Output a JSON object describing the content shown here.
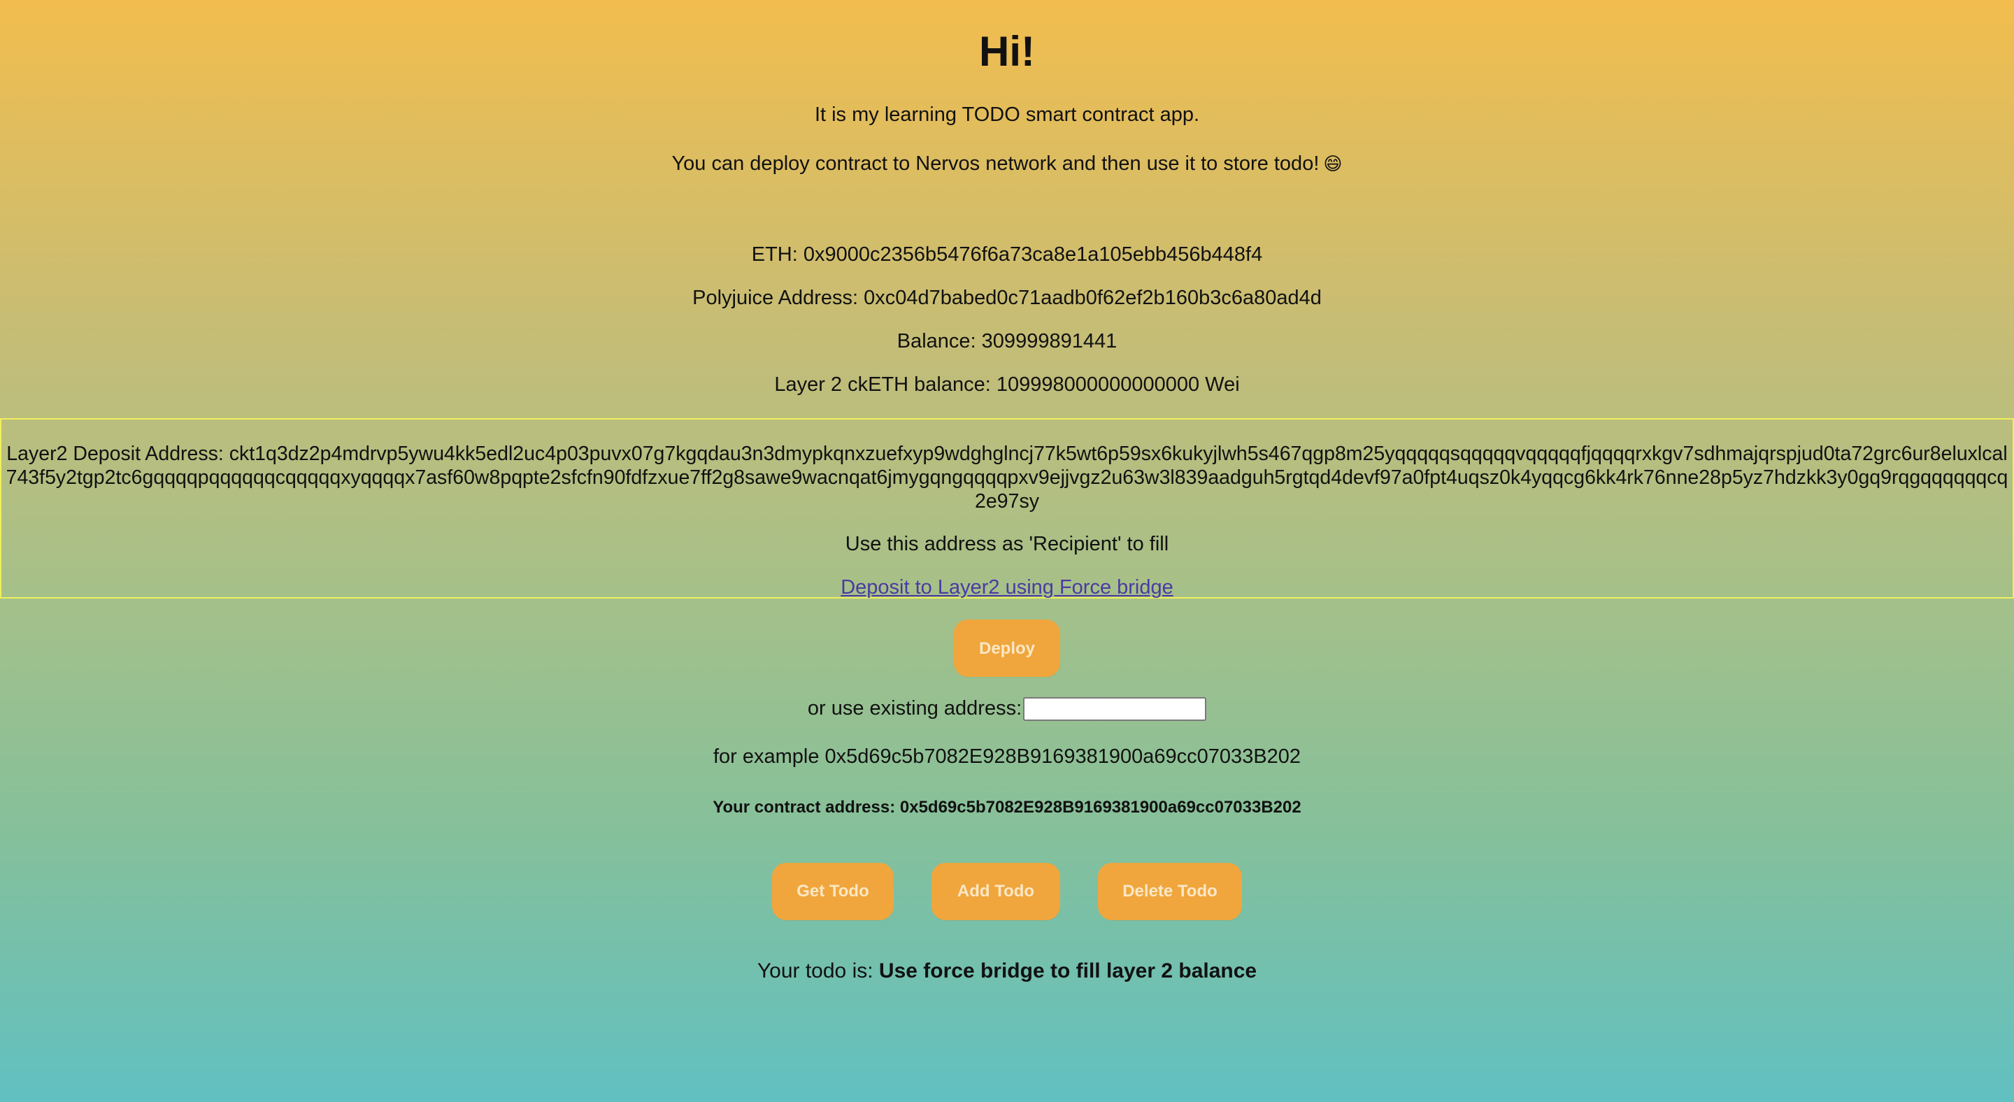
{
  "page": {
    "title": "Hi!",
    "intro_line_1": "It is my learning TODO smart contract app.",
    "intro_line_2": "You can deploy contract to Nervos network and then use it to store todo!",
    "intro_emoji": "😄"
  },
  "account": {
    "eth": "ETH: 0x9000c2356b5476f6a73ca8e1a105ebb456b448f4",
    "polyjuice": "Polyjuice Address: 0xc04d7babed0c71aadb0f62ef2b160b3c6a80ad4d",
    "balance": "Balance: 309999891441",
    "cketh_balance": "Layer 2 ckETH balance: 109998000000000000 Wei"
  },
  "deposit": {
    "address_text": "Layer2 Deposit Address: ckt1q3dz2p4mdrvp5ywu4kk5edl2uc4p03puvx07g7kgqdau3n3dmypkqnxzuefxyp9wdghglncj77k5wt6p59sx6kukyjlwh5s467qgp8m25yqqqqqsqqqqqvqqqqqfjqqqqrxkgv7sdhmajqrspjud0ta72grc6ur8eluxlcal743f5y2tgp2tc6gqqqqpqqqqqqcqqqqqxyqqqqx7asf60w8pqpte2sfcfn90fdfzxue7ff2g8sawe9wacnqat6jmygqngqqqqpxv9ejjvgz2u63w3l839aadguh5rgtqd4devf97a0fpt4uqsz0k4yqqcg6kk4rk76nne28p5yz7hdzkk3y0gq9rqgqqqqqqcq2e97sy",
    "hint": "Use this address as 'Recipient' to fill",
    "link_label": "Deposit to Layer2 using Force bridge"
  },
  "contract": {
    "deploy_label": "Deploy",
    "existing_label": "or use existing address:",
    "existing_value": "",
    "example": "for example 0x5d69c5b7082E928B9169381900a69cc07033B202",
    "address_line": "Your contract address: 0x5d69c5b7082E928B9169381900a69cc07033B202"
  },
  "actions": {
    "get_label": "Get Todo",
    "add_label": "Add Todo",
    "delete_label": "Delete Todo"
  },
  "todo": {
    "prefix": "Your todo is: ",
    "value": "Use force bridge to fill layer 2 balance"
  },
  "colors": {
    "gradient_top": "#f2bd4e",
    "gradient_bottom": "#61c0c1",
    "button": "#f0a63c",
    "button_text": "#fbe7c6",
    "link": "#4b3aa3",
    "deposit_border": "#eef05a"
  }
}
